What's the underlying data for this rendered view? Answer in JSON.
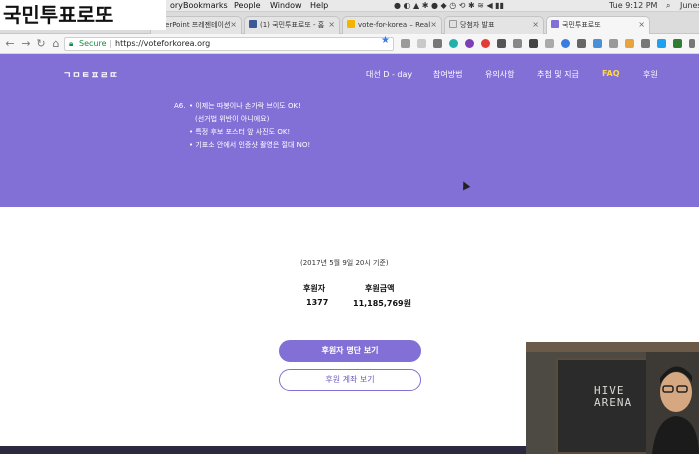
{
  "overlay_title": "국민투표로또",
  "menubar": {
    "items": [
      "ory",
      "Bookmarks",
      "People",
      "Window",
      "Help"
    ],
    "time": "Tue 9:12 PM",
    "user": "Junes"
  },
  "tabs": [
    {
      "label": "owerPoint 프레젠테이션",
      "active": false,
      "favicon_color": "#d24726"
    },
    {
      "label": "(1) 국민투표로또 - 홈",
      "active": false,
      "favicon_color": "#3b5998"
    },
    {
      "label": "vote-for-korea – Real",
      "active": false,
      "favicon_color": "#f4b400"
    },
    {
      "label": "당첨자 발표",
      "active": false,
      "favicon_color": "#888888"
    },
    {
      "label": "국민투표로또",
      "active": true,
      "favicon_color": "#8270d6"
    }
  ],
  "address": {
    "secure_label": "Secure",
    "url": "https://voteforkorea.org"
  },
  "site": {
    "logo": "ㄱㅁㅌㅍㄹㄸ",
    "nav": [
      "대선 D - day",
      "참여방법",
      "유의사항",
      "추첨 및 지급",
      "FAQ",
      "후원"
    ],
    "faq": {
      "answer_label": "A6.",
      "bullet1": "• 이제는 따봉이나 손가락 브이도 OK!",
      "bullet1_sub": "(선거법 위반이 아니에요)",
      "bullet2": "• 특정 후보 포스터 앞 사진도 OK!",
      "bullet3": "• 기표소 안에서 인증샷 촬영은 절대 NO!"
    }
  },
  "donation": {
    "as_of": "(2017년 5월 9일 20시 기준)",
    "donors_label": "후원자",
    "donors_value": "1377",
    "amount_label": "후원금액",
    "amount_value": "11,185,769원",
    "list_button": "후원자 명단 보기",
    "account_button": "후원 계좌 보기"
  },
  "webcam": {
    "board_text": "HIVE\nARENA"
  },
  "colors": {
    "brand": "#8270d6",
    "faq_highlight": "#ffd84a"
  }
}
